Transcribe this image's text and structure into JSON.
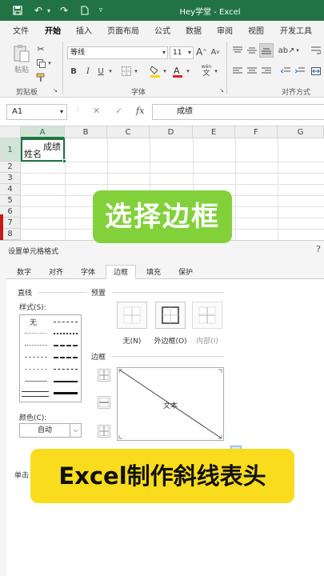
{
  "titlebar": {
    "title": "Hey学堂  -  Excel",
    "quick_access": [
      "save-icon",
      "undo-icon",
      "redo-icon",
      "new-file-icon",
      "customize-icon"
    ]
  },
  "menu": {
    "tabs": [
      "文件",
      "开始",
      "插入",
      "页面布局",
      "公式",
      "数据",
      "审阅",
      "视图",
      "开发工具"
    ],
    "active": "开始"
  },
  "ribbon": {
    "paste_label": "粘贴",
    "clipboard_label": "剪贴板",
    "font_group_label": "字体",
    "align_group_label": "对齐方式",
    "font_name": "等线",
    "font_size": "11",
    "bold": "B",
    "italic": "I",
    "underline": "U",
    "grow_font": "A",
    "shrink_font": "A",
    "wen": "wén",
    "font_color": "#e02020",
    "fill_color": "#ffd400"
  },
  "formula_bar": {
    "name_box": "A1",
    "cancel": "✕",
    "enter": "✓",
    "fx": "fx",
    "content": "成绩"
  },
  "sheet": {
    "columns": [
      "A",
      "B",
      "C",
      "D",
      "E",
      "F",
      "G"
    ],
    "rows": [
      "1",
      "2",
      "3",
      "4",
      "5",
      "6",
      "7",
      "8"
    ],
    "a1_top": "成绩",
    "a1_bottom": "姓名"
  },
  "dialog": {
    "title": "设置单元格格式",
    "help": "?",
    "tabs": [
      "数字",
      "对齐",
      "字体",
      "边框",
      "填充",
      "保护"
    ],
    "active_tab": "边框",
    "line_section": "直线",
    "style_label": "样式(S):",
    "none_style": "无",
    "color_label": "颜色(C):",
    "color_value": "自动",
    "preset_section": "预置",
    "presets": [
      "无(N)",
      "外边框(O)",
      "内部(I)"
    ],
    "border_section": "边框",
    "preview_text": "文本",
    "hint": "单击"
  },
  "overlay": {
    "title": "选择边框",
    "caption": "Excel制作斜线表头",
    "title_bg": "#82d13b",
    "caption_bg": "#f8dc1d"
  }
}
